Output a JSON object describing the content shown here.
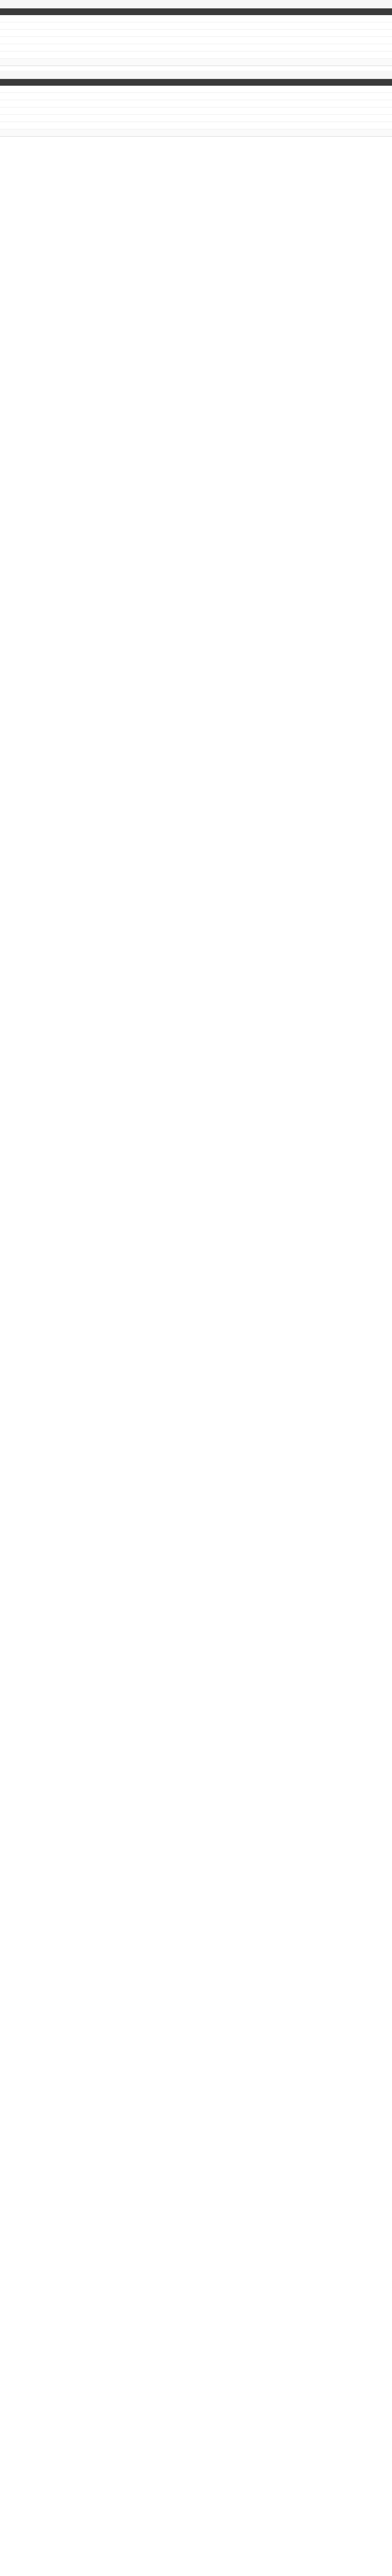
{
  "sheet": {
    "header_labels": {
      "name": "",
      "buy": "",
      "sell": "",
      "qty": "",
      "amount": "",
      "pl": "",
      "ret": ""
    },
    "sections": [
      {
        "date_label": "",
        "date_value_1": "",
        "date_value_2": "",
        "date_value_3": "",
        "date_value_4": "",
        "date_value_5": "",
        "date_value_6": "",
        "rows": [
          {
            "name": "",
            "buy": "",
            "sell": "",
            "qty": "",
            "amount": "",
            "pl": "",
            "ret": ""
          },
          {
            "name": "",
            "buy": "",
            "sell": "",
            "qty": "",
            "amount": "",
            "pl": "",
            "ret": ""
          },
          {
            "name": "",
            "buy": "",
            "sell": "",
            "qty": "",
            "amount": "",
            "pl": "",
            "ret": ""
          },
          {
            "name": "",
            "buy": "",
            "sell": "",
            "qty": "",
            "amount": "",
            "pl": "",
            "ret": ""
          },
          {
            "name": "",
            "buy": "",
            "sell": "",
            "qty": "",
            "amount": "",
            "pl": "",
            "ret": ""
          },
          {
            "name": "",
            "buy": "",
            "sell": "",
            "qty": "",
            "amount": "",
            "pl": "",
            "ret": ""
          }
        ],
        "summary": {
          "label": "",
          "buy": "",
          "sell": "",
          "qty": "",
          "amount": "",
          "pl": "",
          "ret": ""
        }
      },
      {
        "date_label": "",
        "date_value_1": "",
        "date_value_2": "",
        "date_value_3": "",
        "date_value_4": "",
        "date_value_5": "",
        "date_value_6": "",
        "rows": [
          {
            "name": "",
            "buy": "",
            "sell": "",
            "qty": "",
            "amount": "",
            "pl": "",
            "ret": ""
          },
          {
            "name": "",
            "buy": "",
            "sell": "",
            "qty": "",
            "amount": "",
            "pl": "",
            "ret": ""
          },
          {
            "name": "",
            "buy": "",
            "sell": "",
            "qty": "",
            "amount": "",
            "pl": "",
            "ret": ""
          },
          {
            "name": "",
            "buy": "",
            "sell": "",
            "qty": "",
            "amount": "",
            "pl": "",
            "ret": ""
          },
          {
            "name": "",
            "buy": "",
            "sell": "",
            "qty": "",
            "amount": "",
            "pl": "",
            "ret": ""
          },
          {
            "name": "",
            "buy": "",
            "sell": "",
            "qty": "",
            "amount": "",
            "pl": "",
            "ret": ""
          }
        ],
        "summary": {
          "label": "",
          "buy": "",
          "sell": "",
          "qty": "",
          "amount": "",
          "pl": "",
          "ret": ""
        }
      }
    ]
  }
}
